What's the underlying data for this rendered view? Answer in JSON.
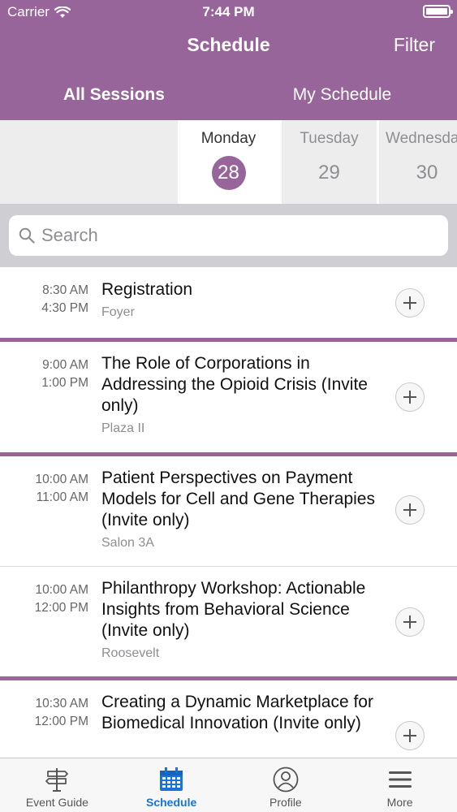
{
  "status": {
    "carrier": "Carrier",
    "time": "7:44 PM"
  },
  "nav": {
    "title": "Schedule",
    "filter_label": "Filter"
  },
  "tabs": [
    {
      "label": "All Sessions",
      "active": true
    },
    {
      "label": "My Schedule",
      "active": false
    }
  ],
  "days": [
    {
      "name": "Monday",
      "number": "28",
      "selected": true
    },
    {
      "name": "Tuesday",
      "number": "29",
      "selected": false
    },
    {
      "name": "Wednesda",
      "number": "30",
      "selected": false
    }
  ],
  "search": {
    "placeholder": "Search",
    "value": ""
  },
  "sessions": [
    {
      "start": "8:30 AM",
      "end": "4:30 PM",
      "title": "Registration",
      "location": "Foyer"
    },
    {
      "start": "9:00 AM",
      "end": "1:00 PM",
      "title": "The Role of Corporations in Addressing the Opioid Crisis (Invite only)",
      "location": "Plaza II"
    },
    {
      "start": "10:00 AM",
      "end": "11:00 AM",
      "title": "Patient Perspectives on Payment Models for Cell and Gene Therapies (Invite only)",
      "location": "Salon 3A"
    },
    {
      "start": "10:00 AM",
      "end": "12:00 PM",
      "title": "Philanthropy Workshop: Actionable Insights from Behavioral Science (Invite only)",
      "location": "Roosevelt"
    },
    {
      "start": "10:30 AM",
      "end": "12:00 PM",
      "title": "Creating a Dynamic Marketplace for Biomedical Innovation (Invite only)",
      "location": ""
    }
  ],
  "tabbar": [
    {
      "label": "Event Guide",
      "icon": "signpost-icon",
      "active": false
    },
    {
      "label": "Schedule",
      "icon": "calendar-icon",
      "active": true
    },
    {
      "label": "Profile",
      "icon": "profile-icon",
      "active": false
    },
    {
      "label": "More",
      "icon": "menu-icon",
      "active": false
    }
  ],
  "colors": {
    "brand": "#98659a",
    "active_tab": "#1a73d9"
  }
}
